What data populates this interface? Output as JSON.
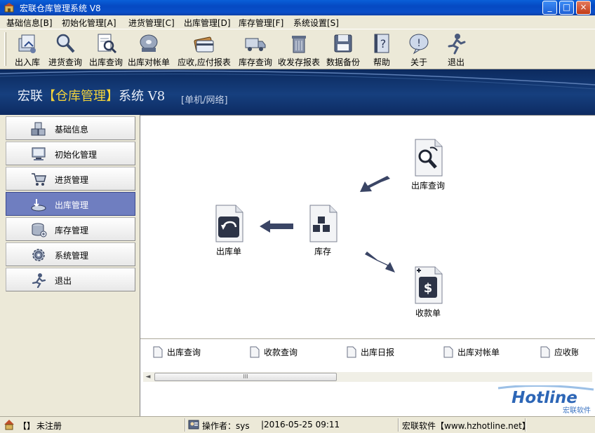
{
  "window": {
    "title": "宏联仓库管理系统 V8",
    "buttons": {
      "minimize": "_",
      "maximize": "□",
      "close": "×"
    }
  },
  "menu": {
    "items": [
      "基础信息[B]",
      "初始化管理[A]",
      "进货管理[C]",
      "出库管理[D]",
      "库存管理[F]",
      "系统设置[S]"
    ]
  },
  "toolbar": {
    "items": [
      {
        "label": "出入库",
        "icon": "in-out-icon"
      },
      {
        "label": "进货查询",
        "icon": "magnifier-icon"
      },
      {
        "label": "出库查询",
        "icon": "search-doc-icon"
      },
      {
        "label": "出库对帐单",
        "icon": "disk-drive-icon"
      },
      {
        "label": "应收,应付报表",
        "icon": "card-icon"
      },
      {
        "label": "库存查询",
        "icon": "truck-icon"
      },
      {
        "label": "收发存报表",
        "icon": "trash-bin-icon"
      },
      {
        "label": "数据备份",
        "icon": "floppy-icon"
      },
      {
        "label": "帮助",
        "icon": "help-book-icon"
      },
      {
        "label": "关于",
        "icon": "info-bubble-icon"
      },
      {
        "label": "退出",
        "icon": "running-man-icon"
      }
    ]
  },
  "banner": {
    "prefix": "宏联",
    "highlight": "【仓库管理】",
    "suffix": "系统  V8",
    "subtitle": "[单机/网络]"
  },
  "sidebar": {
    "items": [
      {
        "label": "基础信息",
        "icon": "boxes-icon",
        "active": false
      },
      {
        "label": "初始化管理",
        "icon": "monitor-icon",
        "active": false
      },
      {
        "label": "进货管理",
        "icon": "cart-icon",
        "active": false
      },
      {
        "label": "出库管理",
        "icon": "outbound-icon",
        "active": true
      },
      {
        "label": "库存管理",
        "icon": "storage-icon",
        "active": false
      },
      {
        "label": "系统管理",
        "icon": "gears-icon",
        "active": false
      },
      {
        "label": "退出",
        "icon": "running-man-icon",
        "active": false
      }
    ]
  },
  "diagram": {
    "nodes": {
      "out_query": "出库查询",
      "out_order": "出库单",
      "stock": "库存",
      "receipt": "收款单"
    }
  },
  "tabs": {
    "items": [
      "出库查询",
      "收款查询",
      "出库日报",
      "出库对帐单",
      "应收账"
    ],
    "scroll_grip": "III"
  },
  "logo": {
    "text": "Hotline",
    "sub": "宏联软件"
  },
  "status": {
    "icon_text": "【】",
    "registration": "未注册",
    "operator": "操作者：sys",
    "datetime": "|2016-05-25 09:11",
    "company": "宏联软件【www.hzhotline.net】"
  },
  "colors": {
    "title_bar": "#0a4fc9",
    "banner": "#163f7e",
    "banner_highlight": "#f3d33a",
    "active_nav": "#6f7ec0",
    "arrow": "#3a4565"
  }
}
